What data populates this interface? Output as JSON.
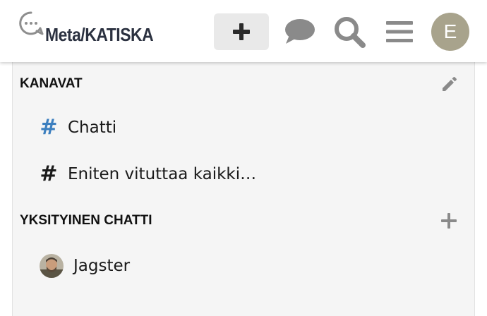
{
  "header": {
    "site_title": "Meta/KATISKA",
    "new_label": "+",
    "user_initial": "E",
    "icons": [
      "chat-logo-icon",
      "plus-icon",
      "chat-bubble-icon",
      "search-icon",
      "hamburger-menu-icon"
    ]
  },
  "sidebar": {
    "channels_heading": "KANAVAT",
    "channels": [
      {
        "hash": "#",
        "label": "Chatti",
        "hash_color": "#3c7fbf"
      },
      {
        "hash": "#",
        "label": "Eniten vituttaa kaikki…",
        "hash_color": "#1a1a1a"
      }
    ],
    "dm_heading": "YKSITYINEN CHATTI",
    "dms": [
      {
        "label": "Jagster"
      }
    ]
  },
  "colors": {
    "avatar_bg": "#a8a38c",
    "icon_gray": "#8a8a8a",
    "sidebar_bg": "#f5f5f5",
    "channel_accent": "#3c7fbf"
  }
}
